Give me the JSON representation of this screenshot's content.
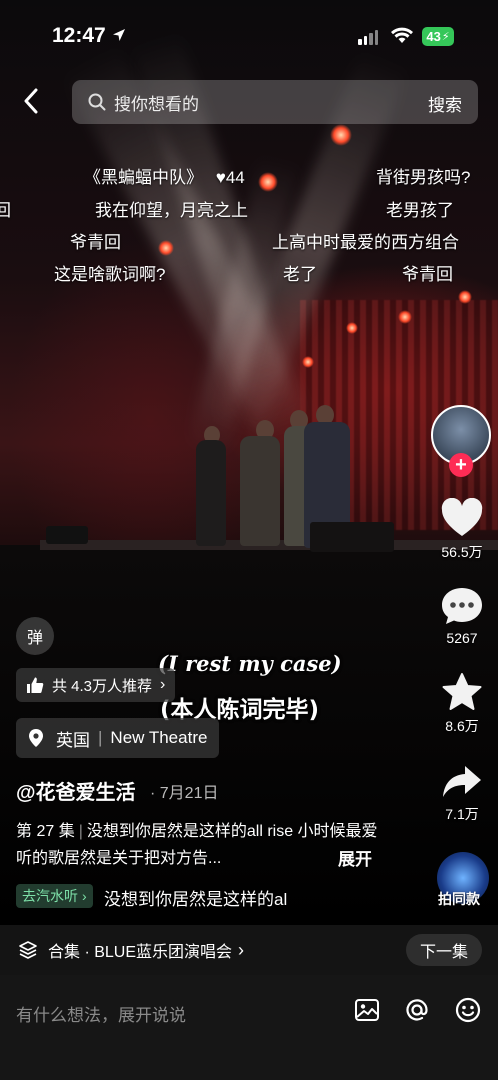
{
  "status_bar": {
    "time": "12:47",
    "battery": "43"
  },
  "search": {
    "placeholder": "搜你想看的",
    "button": "搜索"
  },
  "danmaku": [
    {
      "text": "《黑蝙蝠中队》",
      "likes": "44"
    },
    {
      "text": "背街男孩吗?"
    },
    {
      "text": "回"
    },
    {
      "text": "我在仰望，月亮之上"
    },
    {
      "text": "老男孩了"
    },
    {
      "text": "爷青回"
    },
    {
      "text": "上高中时最爱的西方组合"
    },
    {
      "text": "这是啥歌词啊?"
    },
    {
      "text": "老了"
    },
    {
      "text": "爷青回"
    }
  ],
  "actions": {
    "likes": "56.5万",
    "comments": "5267",
    "favorites": "8.6万",
    "shares": "7.1万",
    "remix_label": "拍同款"
  },
  "subtitles": {
    "en": "(I rest my case)",
    "zh": "(本人陈词完毕)"
  },
  "danmu_toggle": "弹",
  "recommend": "共 4.3万人推荐",
  "location": {
    "country": "英国",
    "place": "New Theatre"
  },
  "author": "@花爸爱生活",
  "date": "· 7月21日",
  "description": {
    "episode": "第 27 集",
    "text": "没想到你居然是这样的all rise 小时候最爱听的歌居然是关于把对方告...",
    "expand": "展开"
  },
  "music": {
    "tag": "去汽水听",
    "title": "没想到你居然是这样的al"
  },
  "collection": {
    "label": "合集 · BLUE蓝乐团演唱会",
    "next": "下一集"
  },
  "comment_input": {
    "placeholder": "有什么想法，展开说说"
  },
  "colors": {
    "like_red": "#fe2c55",
    "battery_green": "#35c759",
    "music_green": "#7de0a8"
  }
}
